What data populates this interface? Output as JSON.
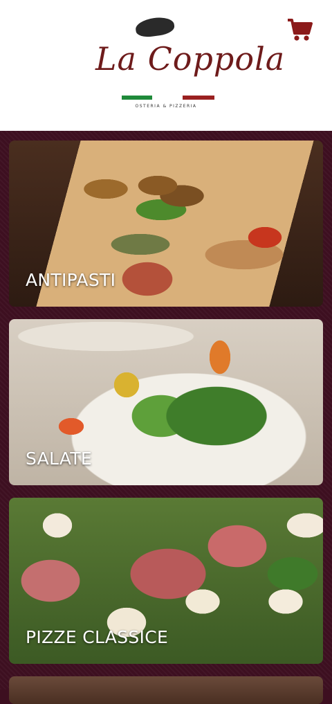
{
  "brand": {
    "name": "La Coppola",
    "subtitle": "OSTERIA & PIZZERIA"
  },
  "header": {
    "cart_icon": "shopping-cart-icon",
    "cart_color": "#8b1a1a"
  },
  "categories": [
    {
      "label": "ANTIPASTI"
    },
    {
      "label": "SALATE"
    },
    {
      "label": "PIZZE CLASSICE"
    },
    {
      "label": ""
    }
  ],
  "colors": {
    "background": "#3d0f20",
    "header_bg": "#ffffff",
    "accent": "#8b1a1a"
  }
}
